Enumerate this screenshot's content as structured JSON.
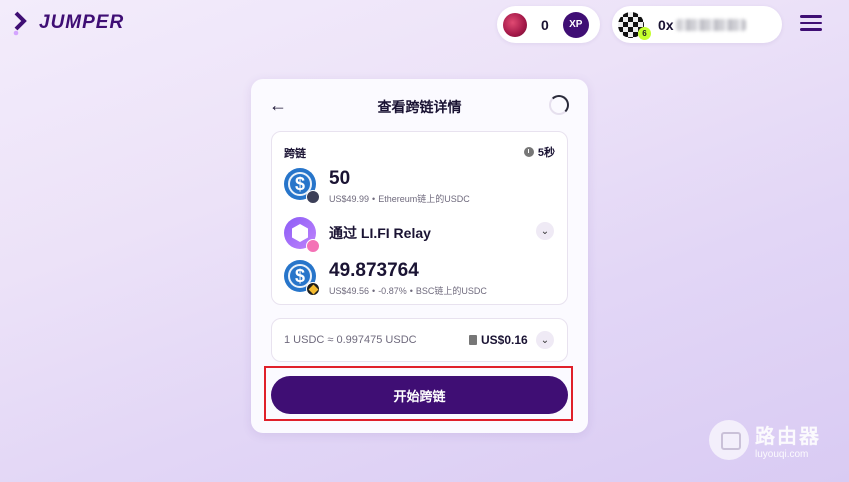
{
  "nav": {
    "brand": "JUMPER",
    "xp_count": "0",
    "xp_badge": "XP",
    "wallet_prefix": "0x",
    "wallet_chain_badge": "6"
  },
  "card": {
    "title": "查看跨链详情",
    "route_label": "跨链",
    "time_estimate": "5秒",
    "from": {
      "amount": "50",
      "usd": "US$49.99",
      "desc": "Ethereum链上的USDC"
    },
    "via": "通过 LI.FI Relay",
    "to": {
      "amount": "49.873764",
      "usd": "US$49.56",
      "change": "-0.87%",
      "desc": "BSC链上的USDC"
    },
    "rate": "1 USDC ≈ 0.997475 USDC",
    "fee": "US$0.16",
    "start_button": "开始跨链"
  },
  "watermark": {
    "main": "路由器",
    "sub": "luyouqi.com"
  },
  "colors": {
    "brand_purple": "#3f0e74",
    "usdc_blue": "#2775ca",
    "highlight_red": "#e0202a"
  }
}
